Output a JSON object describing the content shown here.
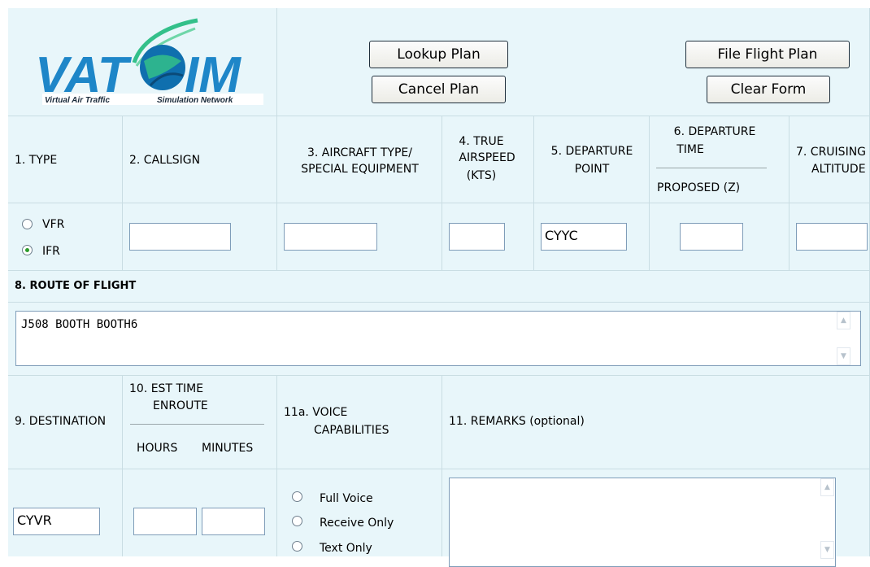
{
  "logo": {
    "brand_left": "VAT",
    "brand_right": "IM",
    "tagline_left": "Virtual Air Traffic",
    "tagline_right": "Simulation Network",
    "colors": {
      "brand": "#1e86c8",
      "swoosh": "#33c08a",
      "dark": "#1a2a3a"
    }
  },
  "buttons": {
    "lookup": "Lookup Plan",
    "cancel": "Cancel Plan",
    "file": "File Flight Plan",
    "clear": "Clear Form"
  },
  "headers": {
    "type": "1. TYPE",
    "callsign": "2. CALLSIGN",
    "aircraft_1": "3. AIRCRAFT TYPE/",
    "aircraft_2": "SPECIAL EQUIPMENT",
    "tas_1": "4. TRUE",
    "tas_2": "AIRSPEED",
    "tas_3": "(KTS)",
    "dep_1": "5. DEPARTURE",
    "dep_2": "POINT",
    "deptime_1": "6. DEPARTURE",
    "deptime_2": "TIME",
    "deptime_sub": "PROPOSED (Z)",
    "alt_1": "7. CRUISING",
    "alt_2": "ALTITUDE",
    "route": "8. ROUTE OF FLIGHT",
    "destination": "9. DESTINATION",
    "ete_1": "10. EST TIME",
    "ete_2": "ENROUTE",
    "ete_hours": "HOURS",
    "ete_minutes": "MINUTES",
    "voice_1": "11a. VOICE",
    "voice_2": "CAPABILITIES",
    "remarks": "11. REMARKS (optional)"
  },
  "flight_type": {
    "options": [
      "VFR",
      "IFR"
    ],
    "selected": "IFR"
  },
  "fields": {
    "callsign": "",
    "aircraft": "",
    "tas": "",
    "departure": "CYYC",
    "departure_time": "",
    "altitude": "",
    "route": "J508 BOOTH BOOTH6",
    "destination": "CYVR",
    "ete_hours": "",
    "ete_minutes": "",
    "remarks": ""
  },
  "voice": {
    "options": [
      "Full Voice",
      "Receive Only",
      "Text Only"
    ],
    "selected": ""
  }
}
